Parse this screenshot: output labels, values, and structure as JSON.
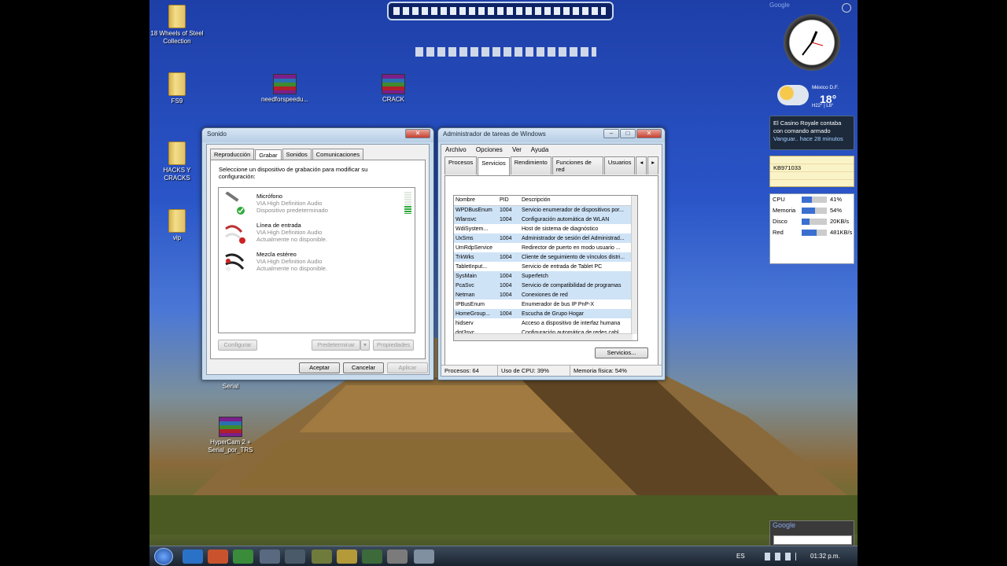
{
  "desktop_icons": [
    {
      "label": "18 Wheels of Steel Collection"
    },
    {
      "label": "FS9"
    },
    {
      "label": "needforspeedu..."
    },
    {
      "label": "CRACK"
    },
    {
      "label": "HACKS Y CRACKS"
    },
    {
      "label": "vip"
    },
    {
      "label": "Serial"
    },
    {
      "label": "HyperCam 2 + Serial_por_TRS"
    }
  ],
  "sound_window": {
    "title": "Sonido",
    "tabs": [
      "Reproducción",
      "Grabar",
      "Sonidos",
      "Comunicaciones"
    ],
    "active_tab": "Grabar",
    "instruction": "Seleccione un dispositivo de grabación para modificar su configuración:",
    "devices": [
      {
        "name": "Micrófono",
        "driver": "VIA High Definition Audio",
        "status": "Dispositivo predeterminado"
      },
      {
        "name": "Línea de entrada",
        "driver": "VIA High Definition Audio",
        "status": "Actualmente no disponible."
      },
      {
        "name": "Mezcla estéreo",
        "driver": "VIA High Definition Audio",
        "status": "Actualmente no disponible."
      }
    ],
    "buttons": {
      "configure": "Configurar",
      "default": "Predeterminar",
      "properties": "Propiedades",
      "accept": "Aceptar",
      "cancel": "Cancelar",
      "apply": "Aplicar"
    }
  },
  "task_manager": {
    "title": "Administrador de tareas de Windows",
    "menu": [
      "Archivo",
      "Opciones",
      "Ver",
      "Ayuda"
    ],
    "tabs": [
      "Procesos",
      "Servicios",
      "Rendimiento",
      "Funciones de red",
      "Usuarios"
    ],
    "active_tab": "Servicios",
    "columns": [
      "Nombre",
      "PID",
      "Descripción"
    ],
    "rows": [
      {
        "name": "WPDBusEnum",
        "pid": "1004",
        "desc": "Servicio enumerador de dispositivos por...",
        "sel": true
      },
      {
        "name": "Wlansvc",
        "pid": "1004",
        "desc": "Configuración automática de WLAN",
        "sel": true
      },
      {
        "name": "WdiSystem...",
        "pid": "",
        "desc": "Host de sistema de diagnóstico",
        "sel": false
      },
      {
        "name": "UxSms",
        "pid": "1004",
        "desc": "Administrador de sesión del Administrad...",
        "sel": true
      },
      {
        "name": "UmRdpService",
        "pid": "",
        "desc": "Redirector de puerto en modo usuario ...",
        "sel": false
      },
      {
        "name": "TrkWks",
        "pid": "1004",
        "desc": "Cliente de seguimiento de vínculos distri...",
        "sel": true
      },
      {
        "name": "TabletInput...",
        "pid": "",
        "desc": "Servicio de entrada de Tablet PC",
        "sel": false
      },
      {
        "name": "SysMain",
        "pid": "1004",
        "desc": "Superfetch",
        "sel": true
      },
      {
        "name": "PcaSvc",
        "pid": "1004",
        "desc": "Servicio de compatibilidad de programas",
        "sel": true
      },
      {
        "name": "Netman",
        "pid": "1004",
        "desc": "Conexiones de red",
        "sel": true
      },
      {
        "name": "IPBusEnum",
        "pid": "",
        "desc": "Enumerador de bus IP PnP-X",
        "sel": false
      },
      {
        "name": "HomeGroup...",
        "pid": "1004",
        "desc": "Escucha de Grupo Hogar",
        "sel": true
      },
      {
        "name": "hidserv",
        "pid": "",
        "desc": "Acceso a dispositivo de interfaz humana",
        "sel": false
      },
      {
        "name": "dot3svc",
        "pid": "",
        "desc": "Configuración automática de redes cabl...",
        "sel": false
      }
    ],
    "services_button": "Servicios...",
    "status": {
      "processes": "Procesos: 64",
      "cpu": "Uso de CPU: 39%",
      "memory": "Memoria física: 54%"
    }
  },
  "gadgets": {
    "google_label": "Google",
    "weather": {
      "location": "México D.F.",
      "temp": "18°",
      "range": "H22° | L8°"
    },
    "news": {
      "headline": "El Casino Royale contaba con comando armado",
      "source": "Vanguar..",
      "age": "hace 28 minutos"
    },
    "note": {
      "text": "KB971033"
    },
    "meter": [
      {
        "label": "CPU",
        "value": "41%",
        "level": 0.41
      },
      {
        "label": "Memoria",
        "value": "54%",
        "level": 0.54
      },
      {
        "label": "Disco",
        "value": "20KB/s",
        "level": 0.3
      },
      {
        "label": "Red",
        "value": "481KB/s",
        "level": 0.6
      }
    ],
    "search_label": "Google"
  },
  "taskbar": {
    "language": "ES",
    "time": "01:32 p.m."
  }
}
